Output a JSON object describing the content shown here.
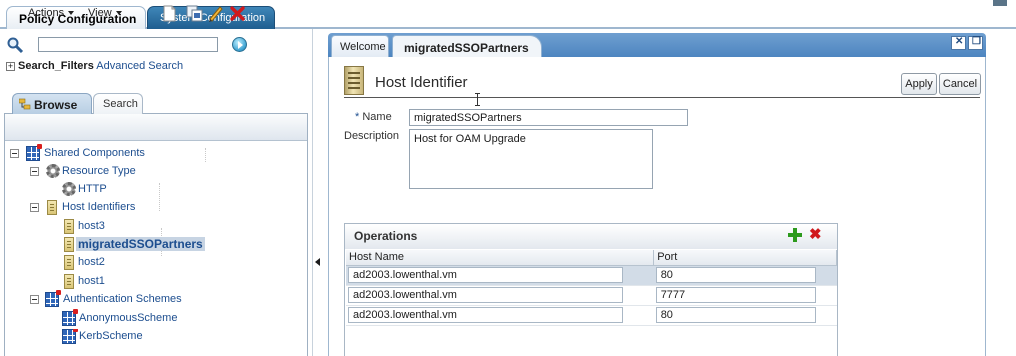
{
  "top_tabs": [
    {
      "label": "Policy Configuration",
      "active": true
    },
    {
      "label": "System Configuration",
      "active": false
    }
  ],
  "search": {
    "value": "",
    "placeholder": ""
  },
  "filters": {
    "label": "Search_Filters",
    "advanced_link": "Advanced Search"
  },
  "browse_tabs": [
    {
      "label": "Browse",
      "active": true
    },
    {
      "label": "Search",
      "active": false
    }
  ],
  "toolbar": {
    "actions_label": "Actions",
    "view_label": "View"
  },
  "tree": {
    "shared_components": "Shared Components",
    "resource_type": "Resource Type",
    "http": "HTTP",
    "host_identifiers": "Host Identifiers",
    "host3": "host3",
    "migrated": "migratedSSOPartners",
    "host2": "host2",
    "host1": "host1",
    "auth_schemes": "Authentication Schemes",
    "anonymous": "AnonymousScheme",
    "kerb": "KerbScheme"
  },
  "content_tabs": [
    {
      "label": "Welcome",
      "active": false
    },
    {
      "label": "migratedSSOPartners",
      "active": true
    }
  ],
  "form": {
    "page_title": "Host Identifier",
    "apply_label": "Apply",
    "cancel_label": "Cancel",
    "name_label": "Name",
    "required_mark": "*",
    "name_value": "migratedSSOPartners",
    "description_label": "Description",
    "description_value": "Host for OAM Upgrade"
  },
  "operations": {
    "title": "Operations",
    "columns": [
      "Host Name",
      "Port"
    ],
    "rows": [
      {
        "host": "ad2003.lowenthal.vm",
        "port": "80"
      },
      {
        "host": "ad2003.lowenthal.vm",
        "port": "7777"
      },
      {
        "host": "ad2003.lowenthal.vm",
        "port": "80"
      }
    ]
  },
  "colors": {
    "accent_blue": "#4d85c0",
    "link_blue": "#1d4e8f",
    "add_green": "#2c9a1c",
    "delete_red": "#d0191c"
  },
  "icons": [
    "search-icon",
    "go-icon",
    "new-icon",
    "duplicate-icon",
    "edit-icon",
    "delete-icon",
    "add-icon",
    "maximize-icon",
    "restore-icon"
  ]
}
